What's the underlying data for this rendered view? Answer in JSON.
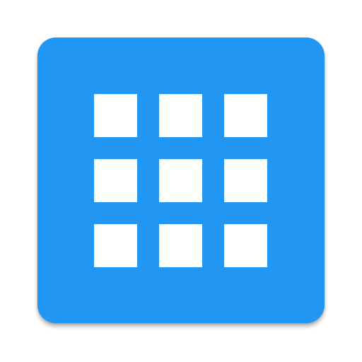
{
  "app_icon": {
    "icon_name": "app-grid-icon",
    "background_color": "#2196F3",
    "glyph_color": "#FFFFFF",
    "grid_rows": 3,
    "grid_columns": 3
  }
}
